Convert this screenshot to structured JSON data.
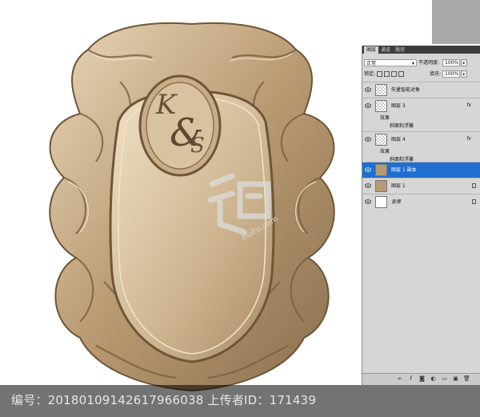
{
  "footer": {
    "text": "编号：20180109142617966038 上传者ID：171439"
  },
  "artwork": {
    "monogram_k": "K",
    "monogram_amp": "&",
    "monogram_s": "S",
    "watermark_site": "huitu.com",
    "colors": {
      "gold_light": "#e8d6b8",
      "gold_mid": "#c6ab86",
      "gold_dark": "#6e5638"
    }
  },
  "layers_panel": {
    "tabs": [
      "图层",
      "通道",
      "路径"
    ],
    "blend_mode": "正常",
    "opacity_label": "不透明度:",
    "opacity_value": "100%",
    "lock_label": "锁定:",
    "fill_label": "填充:",
    "fill_value": "100%",
    "layers": [
      {
        "name": "矢量智能对象",
        "thumb": "checker",
        "fx": "",
        "selected": false
      },
      {
        "name": "图层 3",
        "thumb": "checker",
        "fx": "fx",
        "selected": false
      },
      {
        "name": "图层 4",
        "thumb": "checker",
        "fx": "fx",
        "selected": false
      },
      {
        "name": "图层 1 副本",
        "thumb": "gold",
        "fx": "",
        "selected": true
      },
      {
        "name": "图层 1",
        "thumb": "gold",
        "fx": "",
        "selected": false
      },
      {
        "name": "背景",
        "thumb": "white",
        "fx": "",
        "selected": false
      }
    ],
    "effects_label": "效果",
    "bevel_label": "斜面和浮雕",
    "selection_color": "#1f6fd1"
  }
}
